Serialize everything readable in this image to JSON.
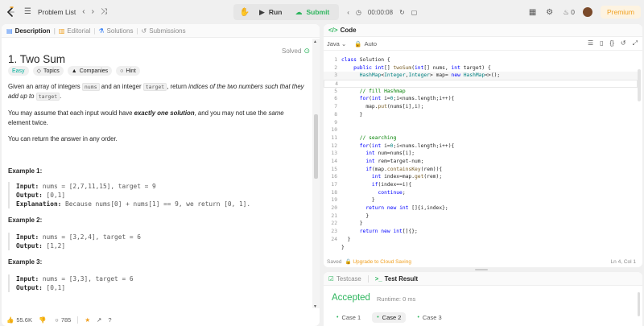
{
  "topbar": {
    "logo": "leetcode-logo",
    "problem_list": "Problem List",
    "run": "Run",
    "submit": "Submit",
    "timer": "00:00:08",
    "streak": "0",
    "premium": "Premium"
  },
  "tabs": {
    "description": "Description",
    "editorial": "Editorial",
    "solutions": "Solutions",
    "submissions": "Submissions"
  },
  "problem": {
    "title": "1. Two Sum",
    "status": "Solved",
    "chips": [
      "Easy",
      "Topics",
      "Companies",
      "Hint"
    ],
    "desc1_a": "Given an array of integers ",
    "desc1_b": "nums",
    "desc1_c": " and an integer ",
    "desc1_d": "target",
    "desc1_e": ", return ",
    "desc1_f": "indices of the two numbers such that they add up to ",
    "desc1_g": "target",
    "desc1_h": ".",
    "desc2_a": "You may assume that each input would have ",
    "desc2_b": "exactly one solution",
    "desc2_c": ", and you may not use the ",
    "desc2_d": "same",
    "desc2_e": " element twice.",
    "desc3": "You can return the answer in any order.",
    "examples": [
      {
        "heading": "Example 1:",
        "input_label": "Input:",
        "input": " nums = [2,7,11,15], target = 9",
        "output_label": "Output:",
        "output": " [0,1]",
        "explanation_label": "Explanation:",
        "explanation": " Because nums[0] + nums[1] == 9, we return [0, 1]."
      },
      {
        "heading": "Example 2:",
        "input_label": "Input:",
        "input": " nums = [3,2,4], target = 6",
        "output_label": "Output:",
        "output": " [1,2]"
      },
      {
        "heading": "Example 3:",
        "input_label": "Input:",
        "input": " nums = [3,3], target = 6",
        "output_label": "Output:",
        "output": " [0,1]"
      }
    ]
  },
  "footer": {
    "likes": "55.6K",
    "comments": "785"
  },
  "code_panel": {
    "title": "Code",
    "language": "Java",
    "mode": "Auto",
    "saved": "Saved",
    "upgrade": "Upgrade to Cloud Saving",
    "cursor": "Ln 4, Col 1"
  },
  "code_lines": [
    "1",
    "2",
    "3",
    "4",
    "5",
    "6",
    "7",
    "8",
    "9",
    "10",
    "11",
    "12",
    "13",
    "14",
    "15",
    "16",
    "17",
    "18",
    "19",
    "20",
    "21",
    "22",
    "23",
    "24"
  ],
  "result_panel": {
    "testcase": "Testcase",
    "test_result": "Test Result",
    "status": "Accepted",
    "runtime": "Runtime: 0 ms",
    "cases": [
      "Case 1",
      "Case 2",
      "Case 3"
    ]
  },
  "colors": {
    "accent_green": "#2db55d",
    "premium_orange": "#f0a020",
    "easy_teal": "#00af9b"
  }
}
